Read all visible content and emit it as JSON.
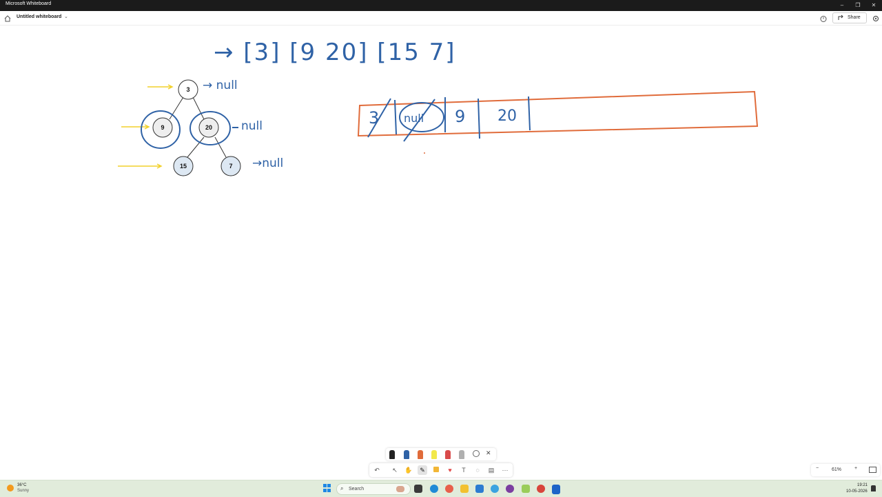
{
  "window": {
    "app_title": "Microsoft Whiteboard",
    "minimize_glyph": "–",
    "restore_glyph": "❐",
    "close_glyph": "✕"
  },
  "header": {
    "doc_title": "Untitled whiteboard",
    "share_label": "Share"
  },
  "whiteboard": {
    "queue_levels_text": "→ [3] [9   20] [15   7]",
    "tree": {
      "root": "3",
      "left": "9",
      "right": "20",
      "right_left": "15",
      "right_right": "7"
    },
    "null_labels": [
      "→ null",
      "null",
      "→null"
    ],
    "queue_box_cells": [
      "3",
      "null",
      "9",
      "20"
    ]
  },
  "toolbar": {
    "undo_glyph": "↶",
    "text_glyph": "T",
    "more_glyph": "···"
  },
  "pen_tray": {
    "close_glyph": "✕",
    "pen_colors": [
      "#222222",
      "#2f62a6",
      "#e06b3a",
      "#f2e84b",
      "#d94b4b",
      "#b0b0b0"
    ]
  },
  "zoom": {
    "level": "61%",
    "zoom_out_glyph": "−",
    "zoom_in_glyph": "+"
  },
  "taskbar": {
    "weather_temp": "36°C",
    "weather_condition": "Sunny",
    "search_label": "Search",
    "time": "19:21",
    "date": "10-05-2026"
  },
  "colors": {
    "ink_blue": "#2f62a6",
    "ink_orange": "#e06b3a",
    "ink_yellow": "#f2d12a",
    "node_fill": "#dde8f3"
  }
}
